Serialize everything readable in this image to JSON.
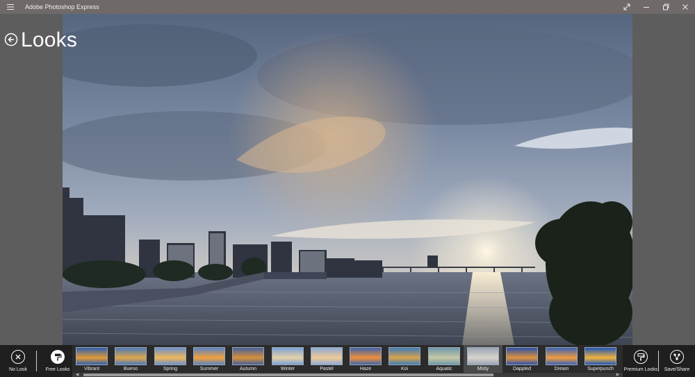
{
  "titlebar": {
    "app_title": "Adobe Photoshop Express",
    "menu_icon": "hamburger-icon",
    "controls": [
      "fullscreen-icon",
      "minimize-icon",
      "restore-icon",
      "close-icon"
    ]
  },
  "header": {
    "back_icon": "back-arrow-icon",
    "title": "Looks"
  },
  "photo": {
    "subject": "city skyline at sunset over river"
  },
  "toolbar": {
    "no_look_label": "No Look",
    "free_looks_label": "Free Looks",
    "premium_looks_label": "Premium Looks",
    "save_share_label": "Save/Share"
  },
  "looks": [
    {
      "label": "Vibrant",
      "thumb": [
        "#2f5fae",
        "#e29a34"
      ]
    },
    {
      "label": "Bueno",
      "thumb": [
        "#4b78b8",
        "#e0a84a"
      ]
    },
    {
      "label": "Spring",
      "thumb": [
        "#6b8fc9",
        "#f0b85a"
      ]
    },
    {
      "label": "Summer",
      "thumb": [
        "#5b82c0",
        "#f2a23c"
      ]
    },
    {
      "label": "Autumn",
      "thumb": [
        "#47609a",
        "#d8903a"
      ]
    },
    {
      "label": "Winter",
      "thumb": [
        "#7aa0d6",
        "#e6d2a4"
      ]
    },
    {
      "label": "Pastel",
      "thumb": [
        "#8faad6",
        "#efc995"
      ]
    },
    {
      "label": "Haze",
      "thumb": [
        "#3f64a8",
        "#ee8f3c"
      ]
    },
    {
      "label": "Koi",
      "thumb": [
        "#3f7cb8",
        "#d9a24a"
      ]
    },
    {
      "label": "Aquatic",
      "thumb": [
        "#6f98a8",
        "#c7c9a6"
      ]
    },
    {
      "label": "Misty",
      "thumb": [
        "#9aa4b4",
        "#d8d4cc"
      ]
    },
    {
      "label": "Dappled",
      "thumb": [
        "#2d4fa8",
        "#e0943c"
      ]
    },
    {
      "label": "Dream",
      "thumb": [
        "#3a62b6",
        "#f09c3e"
      ]
    },
    {
      "label": "Superpunch",
      "thumb": [
        "#1f55b8",
        "#f2b43a"
      ]
    }
  ],
  "selected_look": "Misty"
}
